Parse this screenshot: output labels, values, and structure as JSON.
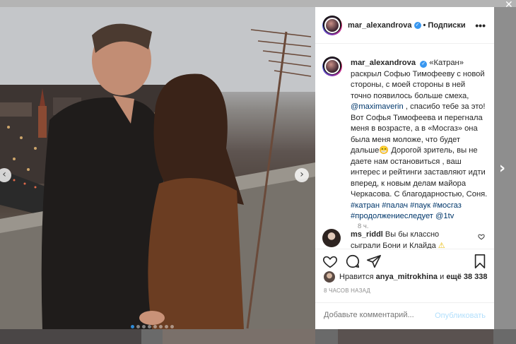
{
  "post": {
    "username": "mar_alexandrova",
    "follow_label": "Подписки",
    "more_label": "•••",
    "caption_username": "mar_alexandrova",
    "caption_lines": [
      "«Катран»",
      "раскрыл Софью Тимофееву с новой",
      "стороны, с моей стороны в ней",
      "точно появилось больше смеха,"
    ],
    "mention1": "@maximaverin",
    "caption_after_mention": " , спасибо тебе за это!",
    "caption_rest_lines": [
      "Вот Софья Тимофеева и перегнала",
      "меня в возрасте, а в «Мосгаз» она",
      "была меня моложе, что будет",
      "дальше😁 Дорогой зритель, вы не",
      "даете нам остановиться , ваш",
      "интерес и рейтинги заставляют идти",
      "вперед, к новым делам майора",
      "Черкасова. С благодарностью, Соня."
    ],
    "hashtags_line1": "#катран #палач #паук #мосгаз",
    "hashtags_line2": "#продолжениеследует",
    "mention2": "@1tv",
    "time": "8 ч.",
    "comment": {
      "username": "ms_riddl",
      "text": "Вы бы классно сыграли Бони и Клайда",
      "emoji": "⚠"
    },
    "likes_prefix": "Нравится",
    "likes_user": "anya_mitrokhina",
    "likes_and": "и",
    "likes_more": "ещё 38 338",
    "ago": "8 ЧАСОВ НАЗАД",
    "add_comment_placeholder": "Добавьте комментарий...",
    "post_button": "Опубликовать"
  },
  "ui": {
    "prev_arrow": "‹",
    "next_arrow": "›",
    "next_post_arrow": "›",
    "close_label": "✕",
    "carousel_count": 8,
    "carousel_active": 0
  },
  "icons": {
    "like": "heart-icon",
    "comment": "comment-icon",
    "share": "share-icon",
    "save": "bookmark-icon"
  }
}
